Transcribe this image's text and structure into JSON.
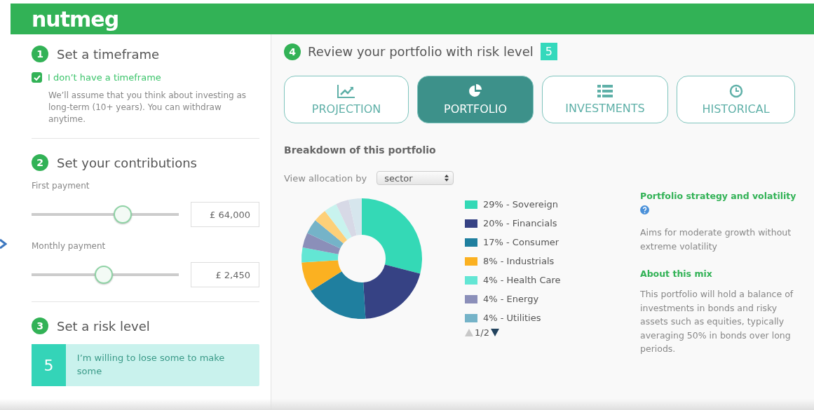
{
  "header": {
    "logo": "nutmeg"
  },
  "steps": [
    {
      "number": "1",
      "title": "Set a timeframe"
    },
    {
      "number": "2",
      "title": "Set your contributions"
    },
    {
      "number": "3",
      "title": "Set a risk level"
    }
  ],
  "timeframe": {
    "checkbox": {
      "label": "I don’t have a timeframe",
      "checked": true
    },
    "note": "We’ll assume that you think about investing as long-term (10+ years). You can withdraw anytime."
  },
  "contributions": [
    {
      "label": "First payment",
      "level": 0.62,
      "value": "£ 64,000"
    },
    {
      "label": "Monthly payment",
      "level": 0.49,
      "value": "£ 2,450"
    }
  ],
  "risk": {
    "level": "5",
    "description": "I’m willing to lose some to make some"
  },
  "review": {
    "number": "4",
    "title": "Review your portfolio with risk level",
    "level": "5"
  },
  "tabs": [
    {
      "label": "PROJECTION",
      "selected": false
    },
    {
      "label": "PORTFOLIO",
      "selected": true
    },
    {
      "label": "INVESTMENTS",
      "selected": false
    },
    {
      "label": "HISTORICAL",
      "selected": false
    }
  ],
  "breakdown": {
    "title": "Breakdown of this portfolio",
    "view_label": "View allocation by",
    "view_select": "sector",
    "legend": [
      {
        "label": "29% - Sovereign",
        "color": "#34d9b6"
      },
      {
        "label": "20% - Financials",
        "color": "#364284"
      },
      {
        "label": "17% - Consumer",
        "color": "#1f7f9f"
      },
      {
        "label": "8% - Industrials",
        "color": "#fbb121"
      },
      {
        "label": "4% - Health Care",
        "color": "#63e6d4"
      },
      {
        "label": "4% - Energy",
        "color": "#8b8fb9"
      },
      {
        "label": "4% - Utilities",
        "color": "#75b3c8"
      }
    ],
    "pager": "1/2",
    "chart_data": {
      "type": "donut",
      "values": [
        29,
        20,
        17,
        8,
        4,
        4,
        4,
        3.5,
        3.5,
        3.5,
        3.5
      ],
      "colors": [
        "#34d9b6",
        "#364284",
        "#1f7f9f",
        "#fbb121",
        "#63e6d4",
        "#8b8fb9",
        "#75b3c8",
        "#fdd078",
        "#c8f3ee",
        "#d7d9e6",
        "#d6e6ed"
      ]
    }
  },
  "strategy": [
    {
      "title": "Portfolio strategy and volatility",
      "text": "Aims for moderate growth without extreme volatility"
    },
    {
      "title": "About this mix",
      "text": "This portfolio will hold a balance of investments in bonds and risky assets such as equities, typically averaging 50% in bonds over long periods."
    }
  ]
}
